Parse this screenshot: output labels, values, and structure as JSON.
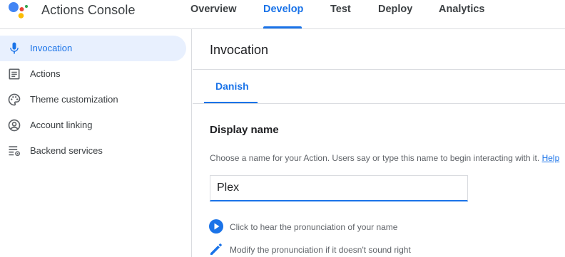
{
  "header": {
    "app_title": "Actions Console",
    "tabs": [
      {
        "label": "Overview"
      },
      {
        "label": "Develop"
      },
      {
        "label": "Test"
      },
      {
        "label": "Deploy"
      },
      {
        "label": "Analytics"
      }
    ],
    "active_tab": "Develop"
  },
  "sidebar": {
    "items": [
      {
        "label": "Invocation",
        "icon": "microphone-icon"
      },
      {
        "label": "Actions",
        "icon": "list-icon"
      },
      {
        "label": "Theme customization",
        "icon": "palette-icon"
      },
      {
        "label": "Account linking",
        "icon": "account-circle-icon"
      },
      {
        "label": "Backend services",
        "icon": "backend-services-icon"
      }
    ],
    "active_item": "Invocation"
  },
  "main": {
    "title": "Invocation",
    "language_tab": "Danish",
    "display_name": {
      "heading": "Display name",
      "help_text": "Choose a name for your Action. Users say or type this name to begin interacting with it.",
      "help_link": "Help",
      "value": "Plex"
    },
    "actions": [
      {
        "label": "Click to hear the pronunciation of your name",
        "icon": "play-circle-icon"
      },
      {
        "label": "Modify the pronunciation if it doesn't sound right",
        "icon": "pencil-icon"
      }
    ]
  },
  "colors": {
    "accent": "#1a73e8",
    "active_bg": "#e8f0fe",
    "text_primary": "#202124",
    "text_secondary": "#5f6368",
    "divider": "#dadce0",
    "logo_blue": "#4285f4",
    "logo_red": "#ea4335",
    "logo_yellow": "#fbbc04",
    "logo_green": "#34a853"
  }
}
